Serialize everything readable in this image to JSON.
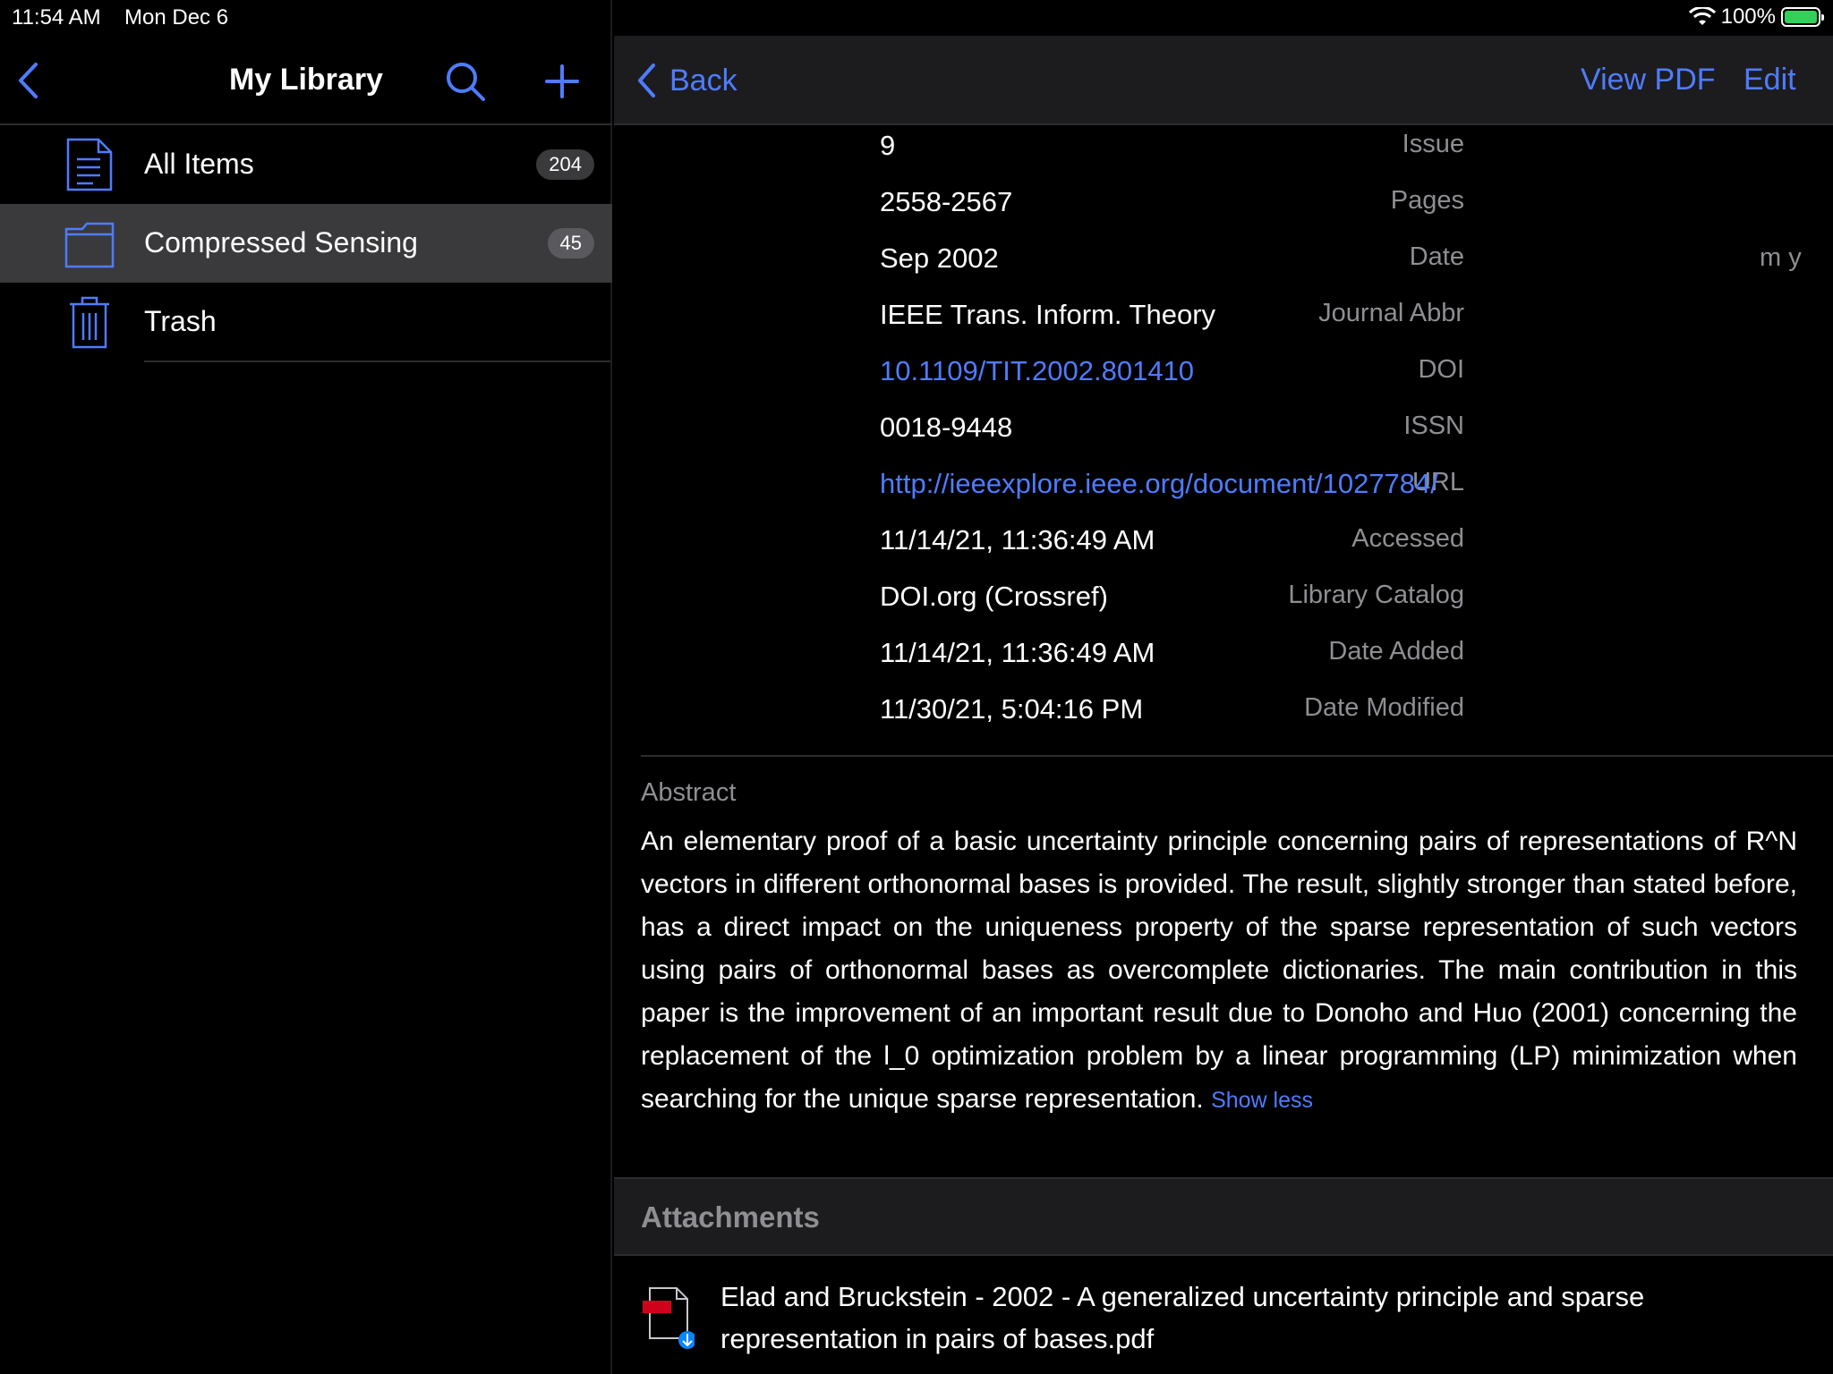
{
  "status": {
    "time": "11:54 AM",
    "date": "Mon Dec 6",
    "battery": "100%"
  },
  "sidebar": {
    "title": "My Library",
    "items": [
      {
        "label": "All Items",
        "count": "204"
      },
      {
        "label": "Compressed Sensing",
        "count": "45"
      },
      {
        "label": "Trash"
      }
    ]
  },
  "detail": {
    "back_label": "Back",
    "view_pdf_label": "View PDF",
    "edit_label": "Edit",
    "fields": [
      {
        "label": "Issue",
        "value": "9"
      },
      {
        "label": "Pages",
        "value": "2558-2567"
      },
      {
        "label": "Date",
        "value": "Sep 2002"
      },
      {
        "label": "Journal Abbr",
        "value": "IEEE Trans. Inform. Theory"
      },
      {
        "label": "DOI",
        "value": "10.1109/TIT.2002.801410"
      },
      {
        "label": "ISSN",
        "value": "0018-9448"
      },
      {
        "label": "URL",
        "value": "http://ieeexplore.ieee.org/document/1027784/"
      },
      {
        "label": "Accessed",
        "value": "11/14/21, 11:36:49 AM"
      },
      {
        "label": "Library Catalog",
        "value": "DOI.org (Crossref)"
      },
      {
        "label": "Date Added",
        "value": "11/14/21, 11:36:49 AM"
      },
      {
        "label": "Date Modified",
        "value": "11/30/21, 5:04:16 PM"
      }
    ],
    "date_format_hint": "m y",
    "abstract_label": "Abstract",
    "abstract_text": "An elementary proof of a basic uncertainty principle concerning pairs of representations of R^N vectors in different orthonormal bases is provided. The result, slightly stronger than stated before, has a direct impact on the uniqueness property of the sparse representation of such vectors using pairs of orthonormal bases as overcomplete dictionaries. The main contribution in this paper is the improvement of an important result due to Donoho and Huo (2001) concerning the replacement of the l_0 optimization problem by a linear programming (LP) minimization when searching for the unique sparse representation.",
    "show_less_label": "Show less",
    "attachments_label": "Attachments",
    "attachment_name": "Elad and Bruckstein - 2002 - A generalized uncertainty principle and sparse representation in pairs of bases.pdf"
  },
  "colors": {
    "accent": "#4f7cff",
    "background": "#000000",
    "secondary_text": "#8e8e93",
    "selected_row": "#3a3a3c"
  },
  "icons": [
    "chevron-left-icon",
    "search-icon",
    "plus-icon",
    "document-icon",
    "folder-icon",
    "trash-icon",
    "wifi-icon",
    "battery-icon",
    "pdf-file-icon",
    "download-icon",
    "more-dots-icon"
  ]
}
